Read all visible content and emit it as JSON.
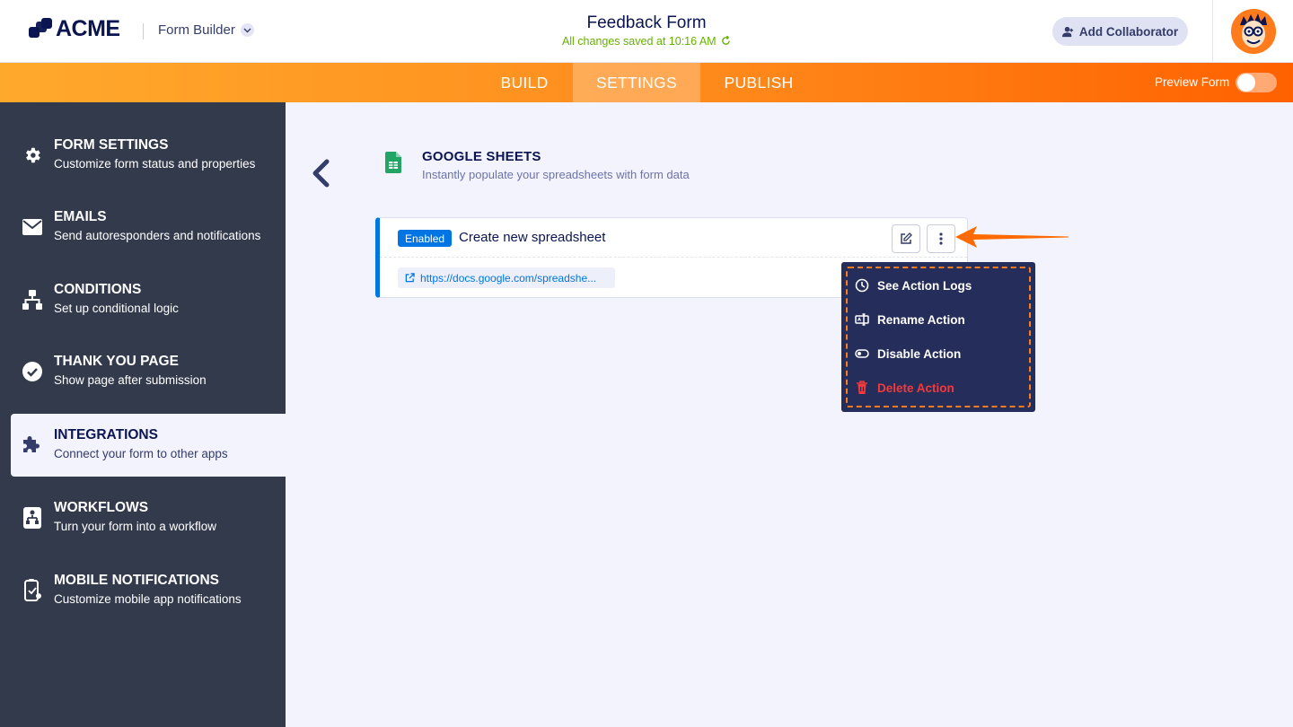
{
  "header": {
    "brand": "ACME",
    "app_switcher": "Form Builder",
    "form_title": "Feedback Form",
    "save_status": "All changes saved at 10:16 AM",
    "collaborator_button": "Add Collaborator"
  },
  "nav": {
    "tabs": [
      {
        "label": "BUILD"
      },
      {
        "label": "SETTINGS"
      },
      {
        "label": "PUBLISH"
      }
    ],
    "active_tab": "SETTINGS",
    "preview_label": "Preview Form",
    "preview_enabled": false
  },
  "sidebar": {
    "items": [
      {
        "title": "FORM SETTINGS",
        "subtitle": "Customize form status and properties",
        "icon": "gear-icon"
      },
      {
        "title": "EMAILS",
        "subtitle": "Send autoresponders and notifications",
        "icon": "envelope-icon"
      },
      {
        "title": "CONDITIONS",
        "subtitle": "Set up conditional logic",
        "icon": "sitemap-icon"
      },
      {
        "title": "THANK YOU PAGE",
        "subtitle": "Show page after submission",
        "icon": "check-circle-icon"
      },
      {
        "title": "INTEGRATIONS",
        "subtitle": "Connect your form to other apps",
        "icon": "puzzle-icon"
      },
      {
        "title": "WORKFLOWS",
        "subtitle": "Turn your form into a workflow",
        "icon": "workflow-icon"
      },
      {
        "title": "MOBILE NOTIFICATIONS",
        "subtitle": "Customize mobile app notifications",
        "icon": "mobile-icon"
      }
    ],
    "active": "INTEGRATIONS"
  },
  "integration": {
    "title": "GOOGLE SHEETS",
    "subtitle": "Instantly populate your spreadsheets with form data",
    "action": {
      "status_badge": "Enabled",
      "title": "Create new spreadsheet",
      "link_text": "https://docs.google.com/spreadshe..."
    }
  },
  "action_menu": {
    "items": [
      {
        "label": "See Action Logs",
        "icon": "clock-icon"
      },
      {
        "label": "Rename Action",
        "icon": "rename-icon"
      },
      {
        "label": "Disable Action",
        "icon": "toggle-off-icon"
      },
      {
        "label": "Delete Action",
        "icon": "trash-icon"
      }
    ]
  },
  "colors": {
    "accent_orange": "#ff7b1c",
    "brand_navy": "#0a1551",
    "sidebar_bg": "#333a4c",
    "enabled_blue": "#0075e3",
    "danger_red": "#f23a3c",
    "saved_green": "#64b200"
  }
}
